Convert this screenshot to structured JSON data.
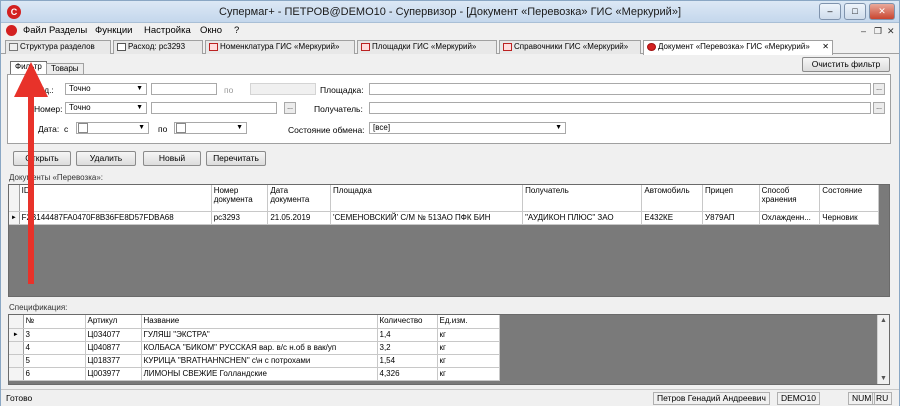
{
  "window": {
    "title": "Супермаг+ - ПЕТРОВ@DEMO10 - Супервизор  - [Документ «Перевозка» ГИС «Меркурий»]",
    "minimize": "–",
    "maximize": "□",
    "close": "✕"
  },
  "menu": {
    "items": [
      "Файл",
      "Разделы",
      "Функции",
      "Настройка",
      "Окно",
      "?"
    ],
    "mdi_minimize": "–",
    "mdi_restore": "❐",
    "mdi_close": "✕"
  },
  "tabs": [
    {
      "label": "Структура разделов"
    },
    {
      "label": "Расход: рс3293"
    },
    {
      "label": "Номенклатура ГИС «Меркурий»"
    },
    {
      "label": "Площадки ГИС «Меркурий»"
    },
    {
      "label": "Справочники ГИС «Меркурий»"
    },
    {
      "label": "Документ «Перевозка» ГИС «Меркурий»",
      "close": "✕"
    }
  ],
  "inner_tabs": [
    "Фильтр",
    "Товары"
  ],
  "filter": {
    "clear_button": "Очистить фильтр",
    "id_label": "Ид.:",
    "id_mode": "Точно",
    "id_to_label": "по",
    "number_label": "Номер:",
    "number_mode": "Точно",
    "date_label": "Дата:",
    "date_from_label": "с",
    "date_to_label": "по",
    "site_label": "Площадка:",
    "receiver_label": "Получатель:",
    "exchange_label": "Состояние обмена:",
    "exchange_value": "[все]",
    "ellipsis": "..."
  },
  "actions": {
    "open": "Открыть",
    "delete": "Удалить",
    "new": "Новый",
    "reread": "Перечитать"
  },
  "documents": {
    "section_label": "Документы «Перевозка»:",
    "columns": [
      "ID",
      "Номер документа",
      "Дата документа",
      "Площадка",
      "Получатель",
      "Автомобиль",
      "Прицеп",
      "Способ хранения",
      "Состояние"
    ],
    "rows": [
      {
        "id": "F2B144487FA0470F8B36FE8D57FDBA68",
        "number": "рс3293",
        "date": "21.05.2019",
        "site": "'СЕМЕНОВСКИЙ' С/М № 513АО ПФК БИН",
        "receiver": "\"АУДИКОН ПЛЮС\" ЗАО",
        "car": "Е432КЕ",
        "trailer": "У879АП",
        "storage": "Охлажденн...",
        "state": "Черновик"
      }
    ]
  },
  "spec": {
    "section_label": "Спецификация:",
    "columns": [
      "№",
      "Артикул",
      "Название",
      "Количество",
      "Ед.изм."
    ],
    "rows": [
      {
        "n": "3",
        "article": "Ц034077",
        "name": "ГУЛЯШ \"ЭКСТРА\"",
        "qty": "1,4",
        "unit": "кг"
      },
      {
        "n": "4",
        "article": "Ц040877",
        "name": "КОЛБАСА \"БИКОМ\" РУССКАЯ вар. в/с н.об в вак/уп",
        "qty": "3,2",
        "unit": "кг"
      },
      {
        "n": "5",
        "article": "Ц018377",
        "name": "КУРИЦА \"BRATHAHNCHEN\" с\\н с потрохами",
        "qty": "1,54",
        "unit": "кг"
      },
      {
        "n": "6",
        "article": "Ц003977",
        "name": "ЛИМОНЫ СВЕЖИЕ Голландские",
        "qty": "4,326",
        "unit": "кг"
      }
    ]
  },
  "status": {
    "text": "Готово",
    "user": "Петров Генадий Андреевич",
    "db": "DEMO10",
    "num": "NUM",
    "lang": "RU"
  },
  "colors": {
    "annotation_arrow": "#e8322a"
  }
}
